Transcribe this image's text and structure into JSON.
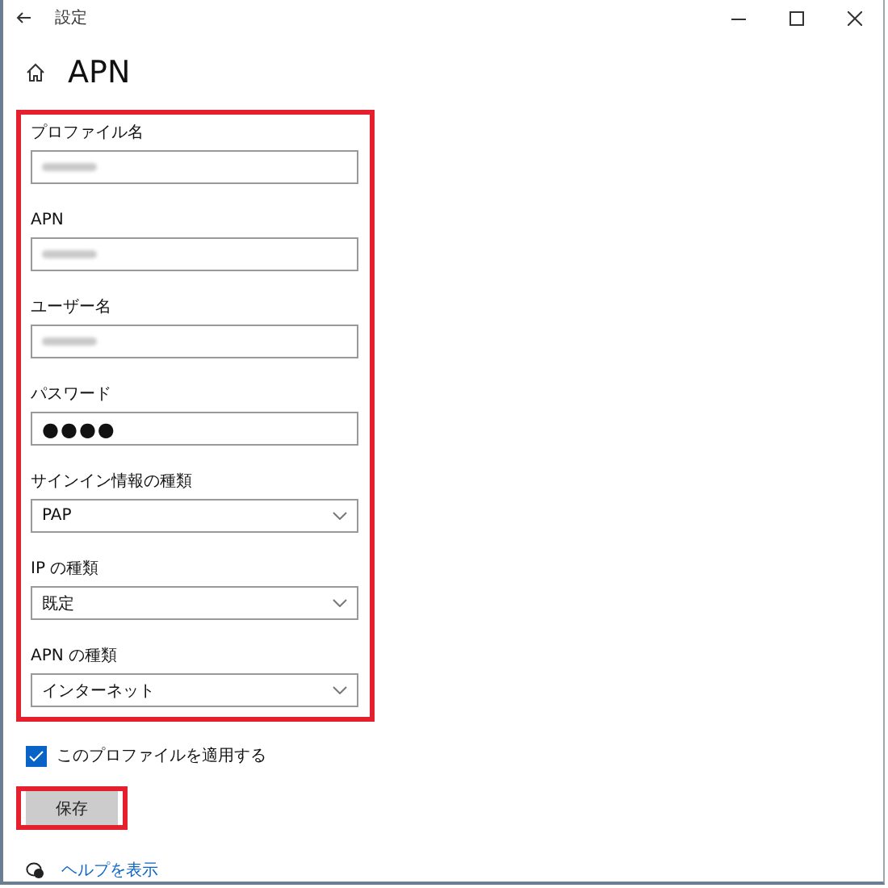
{
  "window": {
    "title": "設定"
  },
  "page": {
    "title": "APN"
  },
  "form": {
    "highlighted": true,
    "fields": [
      {
        "kind": "text",
        "label": "プロファイル名",
        "redacted": true
      },
      {
        "kind": "text",
        "label": "APN",
        "redacted": true
      },
      {
        "kind": "text",
        "label": "ユーザー名",
        "redacted": true
      },
      {
        "kind": "password",
        "label": "パスワード",
        "value": "●●●●"
      },
      {
        "kind": "select",
        "label": "サインイン情報の種類",
        "value": "PAP"
      },
      {
        "kind": "select",
        "label": "IP の種類",
        "value": "既定"
      },
      {
        "kind": "select",
        "label": "APN の種類",
        "value": "インターネット"
      }
    ]
  },
  "apply_checkbox": {
    "label": "このプロファイルを適用する",
    "checked": true
  },
  "save_button": {
    "label": "保存",
    "highlighted": true
  },
  "help_link": {
    "label": "ヘルプを表示"
  }
}
